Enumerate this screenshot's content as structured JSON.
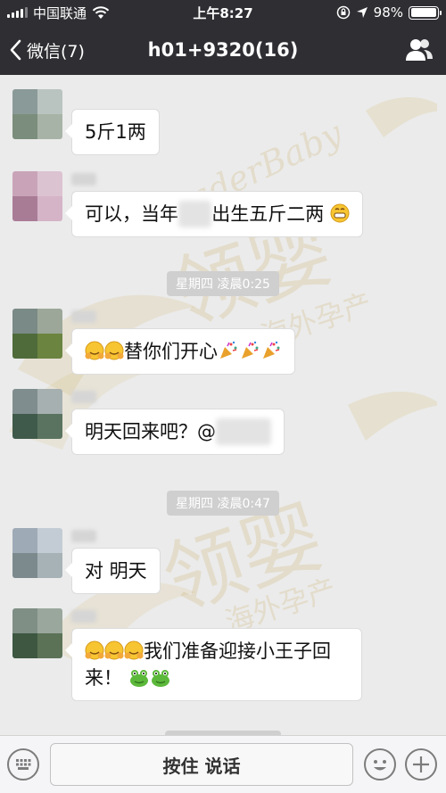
{
  "status_bar": {
    "carrier": "中国联通",
    "time": "上午8:27",
    "battery_percent_text": "98%",
    "battery_level": 0.98
  },
  "nav": {
    "back_label": "微信(7)",
    "title": "h01+9320(16)"
  },
  "watermark": {
    "brand_en": "LeaderBaby",
    "brand_cn": "领婴",
    "tagline_cn": "海外孕产"
  },
  "messages": [
    {
      "text": "5斤1两"
    },
    {
      "text_before": "可以，当年",
      "text_after": "出生五斤二两",
      "emoji": "grinning"
    },
    {
      "timestamp": "星期四 凌晨0:25"
    },
    {
      "text": "替你们开心",
      "emoji_before": "hugging x2",
      "emoji_after": "party-popper x3"
    },
    {
      "text": "明天回来吧？@"
    },
    {
      "timestamp": "星期四 凌晨0:47"
    },
    {
      "text": "对 明天"
    },
    {
      "line1": "我们准备迎接小王子回",
      "line2": "来！",
      "emoji_before": "hugging x3",
      "emoji_after": "frog x2"
    }
  ],
  "input_bar": {
    "hold_to_talk_label": "按住 说话"
  },
  "colors": {
    "header_bg": "#2e2e33",
    "chat_bg": "#ebebeb",
    "bubble_bg": "#ffffff",
    "watermark": "#c8aa5a"
  }
}
